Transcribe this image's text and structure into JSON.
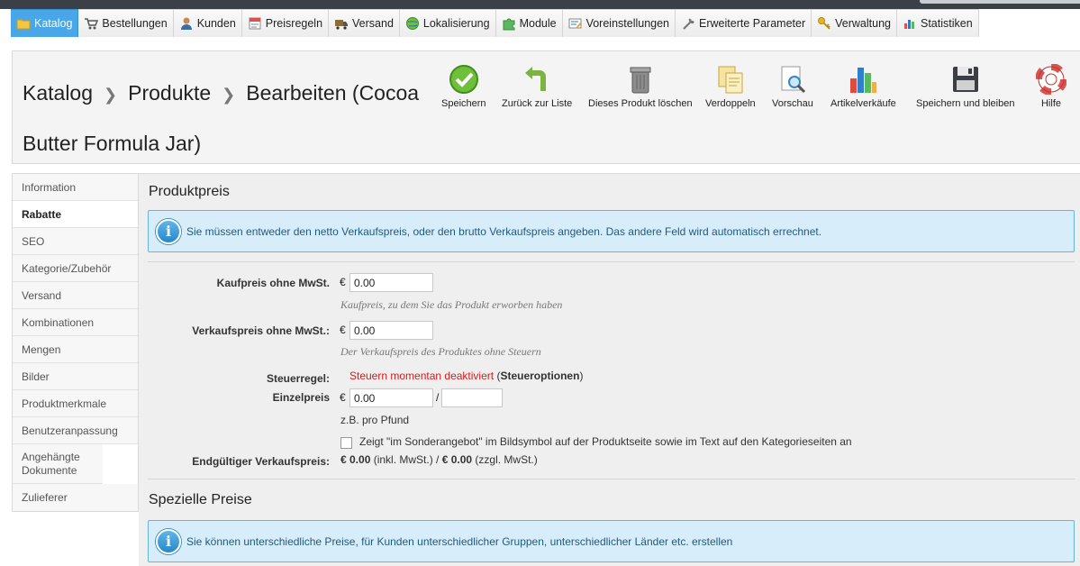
{
  "colors": {
    "accent": "#49a6e9",
    "info_bg": "#d7edf9",
    "info_border": "#66b5e0",
    "tax_text": "#d21d1d"
  },
  "menu": [
    {
      "label": "Katalog",
      "icon": "folder-icon",
      "active": true
    },
    {
      "label": "Bestellungen",
      "icon": "cart-icon"
    },
    {
      "label": "Kunden",
      "icon": "user-icon"
    },
    {
      "label": "Preisregeln",
      "icon": "price-rules-icon"
    },
    {
      "label": "Versand",
      "icon": "truck-icon"
    },
    {
      "label": "Lokalisierung",
      "icon": "globe-icon"
    },
    {
      "label": "Module",
      "icon": "puzzle-icon"
    },
    {
      "label": "Voreinstellungen",
      "icon": "preferences-icon"
    },
    {
      "label": "Erweiterte Parameter",
      "icon": "wrench-icon"
    },
    {
      "label": "Verwaltung",
      "icon": "key-icon"
    },
    {
      "label": "Statistiken",
      "icon": "stats-icon"
    }
  ],
  "breadcrumb": {
    "level1": "Katalog",
    "level2": "Produkte",
    "level3": "Bearbeiten (Cocoa Butter Formula Jar)"
  },
  "toolbar": [
    {
      "label": "Speichern",
      "icon": "save-check-icon"
    },
    {
      "label": "Zurück zur Liste",
      "icon": "back-arrow-icon"
    },
    {
      "label": "Dieses Produkt löschen",
      "icon": "trash-icon"
    },
    {
      "label": "Verdoppeln",
      "icon": "duplicate-icon"
    },
    {
      "label": "Vorschau",
      "icon": "preview-icon"
    },
    {
      "label": "Artikelverkäufe",
      "icon": "sales-chart-icon"
    },
    {
      "label": "Speichern und bleiben",
      "icon": "floppy-disk-icon"
    },
    {
      "label": "Hilfe",
      "icon": "lifebuoy-icon"
    }
  ],
  "sidebar": [
    {
      "label": "Information"
    },
    {
      "label": "Rabatte",
      "active": true
    },
    {
      "label": "SEO"
    },
    {
      "label": "Kategorie/Zubehör"
    },
    {
      "label": "Versand"
    },
    {
      "label": "Kombinationen"
    },
    {
      "label": "Mengen"
    },
    {
      "label": "Bilder"
    },
    {
      "label": "Produktmerkmale"
    },
    {
      "label": "Benutzeranpassung"
    },
    {
      "label": "Angehängte Dokumente"
    },
    {
      "label": "Zulieferer"
    }
  ],
  "price_section": {
    "title": "Produktpreis",
    "info": "Sie müssen entweder den netto Verkaufspreis, oder den brutto Verkaufspreis angeben. Das andere Feld wird automatisch errechnet.",
    "currency": "€",
    "purchase_label": "Kaufpreis ohne MwSt.",
    "purchase_value": "0.00",
    "purchase_hint": "Kaufpreis, zu dem Sie das Produkt erworben haben",
    "sale_label": "Verkaufspreis ohne MwSt.:",
    "sale_value": "0.00",
    "sale_hint": "Der Verkaufspreis des Produktes ohne Steuern",
    "tax_label": "Steuerregel:",
    "tax_status": "Steuern momentan deaktiviert",
    "tax_open": "(",
    "tax_link": "Steueroptionen",
    "tax_close": ")",
    "unit_label": "Einzelpreis",
    "unit_value": "0.00",
    "unit_slash": "/",
    "unit_per_value": "",
    "unit_hint": "z.B. pro Pfund",
    "special_offer_label": "Zeigt \"im Sonderangebot\" im Bildsymbol auf der Produktseite sowie im Text auf den Kategorieseiten an",
    "special_offer_checked": false,
    "final_label": "Endgültiger Verkaufspreis:",
    "final_gross": "€ 0.00",
    "final_gross_note": " (inkl. MwSt.) / ",
    "final_net": "€ 0.00",
    "final_net_note": " (zzgl. MwSt.)"
  },
  "special_section": {
    "title": "Spezielle Preise",
    "info": "Sie können unterschiedliche Preise, für Kunden unterschiedlicher Gruppen, unterschiedlicher Länder etc. erstellen"
  }
}
